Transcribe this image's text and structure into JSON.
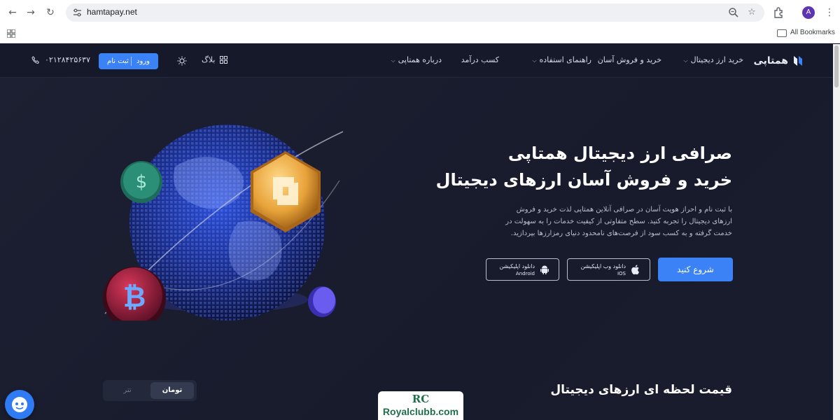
{
  "browser": {
    "url": "hamtapay.net",
    "avatar_letter": "A",
    "bookmarks_label": "All Bookmarks"
  },
  "site": {
    "logo_text": "همتاپی",
    "menu": [
      {
        "label": "خرید ارز دیجیتال",
        "has_dropdown": true
      },
      {
        "label": "خرید و فروش آسان",
        "has_dropdown": false
      },
      {
        "label": "راهنمای استفاده",
        "has_dropdown": true
      },
      {
        "label": "کسب درآمد",
        "has_dropdown": false
      },
      {
        "label": "درباره همتاپی",
        "has_dropdown": true
      }
    ],
    "blog_label": "بلاگ",
    "login_label": "ورود",
    "signup_label": "ثبت نام",
    "phone": "۰۲۱۲۸۴۲۵۶۳۷",
    "accent_color": "#3b82f6"
  },
  "hero": {
    "title_line1": "صرافی ارز دیجیتال همتاپی",
    "title_line2": "خرید و فروش آسان ارزهای دیجیتال",
    "description": "با ثبت نام و احراز هویت آسان در صرافی آنلاین همتاپی لذت خرید و فروش ارزهای دیجیتال را تجربه کنید. سطح متفاوتی از کیفیت خدمات را به سهولت در خدمت گرفته و به کسب سود از فرصت‌های نامحدود دنیای رمزارزها بپردازید.",
    "start_label": "شروع کنید",
    "ios_line1": "دانلود وب اپلیکیشن",
    "ios_line2": "IOS",
    "android_line1": "دانلود اپلیکیشن",
    "android_line2": "Android"
  },
  "prices": {
    "title": "قیمت لحظه ای ارزهای دیجیتال",
    "toggle_active": "تومان",
    "toggle_inactive": "تتر"
  },
  "watermark": {
    "monogram": "RC",
    "text": "Royalclubb.com"
  }
}
